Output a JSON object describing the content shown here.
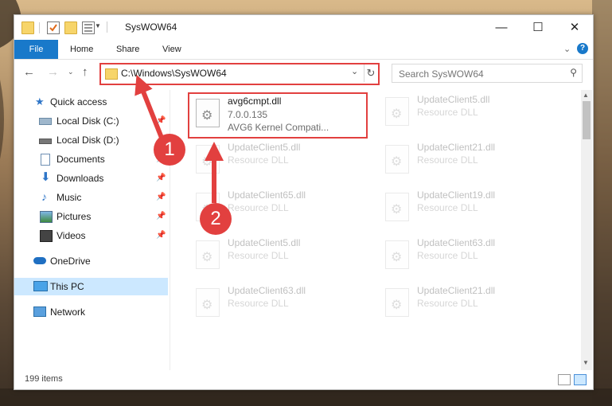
{
  "window": {
    "title": "SysWOW64",
    "controls": {
      "minimize": "—",
      "maximize": "☐",
      "close": "✕"
    }
  },
  "ribbon": {
    "tabs": [
      {
        "label": "File"
      },
      {
        "label": "Home"
      },
      {
        "label": "Share"
      },
      {
        "label": "View"
      }
    ],
    "help_label": "?"
  },
  "address": {
    "path": "C:\\Windows\\SysWOW64",
    "search_placeholder": "Search SysWOW64"
  },
  "sidebar": {
    "items": [
      {
        "label": "Quick access",
        "icon": "star-icon",
        "pinned": false
      },
      {
        "label": "Local Disk (C:)",
        "icon": "drive-icon",
        "pinned": true
      },
      {
        "label": "Local Disk (D:)",
        "icon": "drive-icon",
        "pinned": false
      },
      {
        "label": "Documents",
        "icon": "document-icon",
        "pinned": true
      },
      {
        "label": "Downloads",
        "icon": "download-icon",
        "pinned": true
      },
      {
        "label": "Music",
        "icon": "music-icon",
        "pinned": true
      },
      {
        "label": "Pictures",
        "icon": "pictures-icon",
        "pinned": true
      },
      {
        "label": "Videos",
        "icon": "video-icon",
        "pinned": true
      },
      {
        "label": "OneDrive",
        "icon": "cloud-icon",
        "pinned": false
      },
      {
        "label": "This PC",
        "icon": "computer-icon",
        "pinned": false,
        "selected": true
      },
      {
        "label": "Network",
        "icon": "network-icon",
        "pinned": false
      }
    ]
  },
  "files": {
    "highlighted": {
      "name": "avg6cmpt.dll",
      "version": "7.0.0.135",
      "description": "AVG6 Kernel Compati..."
    },
    "left_column": [
      {
        "name": "UpdateClient5.dll",
        "type": "Resource DLL"
      },
      {
        "name": "UpdateClient65.dll",
        "type": "Resource DLL"
      },
      {
        "name": "UpdateClient5.dll",
        "type": "Resource DLL"
      },
      {
        "name": "UpdateClient63.dll",
        "type": "Resource DLL"
      }
    ],
    "right_column": [
      {
        "name": "UpdateClient5.dll",
        "type": "Resource DLL"
      },
      {
        "name": "UpdateClient21.dll",
        "type": "Resource DLL"
      },
      {
        "name": "UpdateClient19.dll",
        "type": "Resource DLL"
      },
      {
        "name": "UpdateClient63.dll",
        "type": "Resource DLL"
      },
      {
        "name": "UpdateClient21.dll",
        "type": "Resource DLL"
      }
    ]
  },
  "status": {
    "item_count": "199 items"
  },
  "callouts": {
    "step1": "1",
    "step2": "2",
    "color": "#e2403f"
  }
}
